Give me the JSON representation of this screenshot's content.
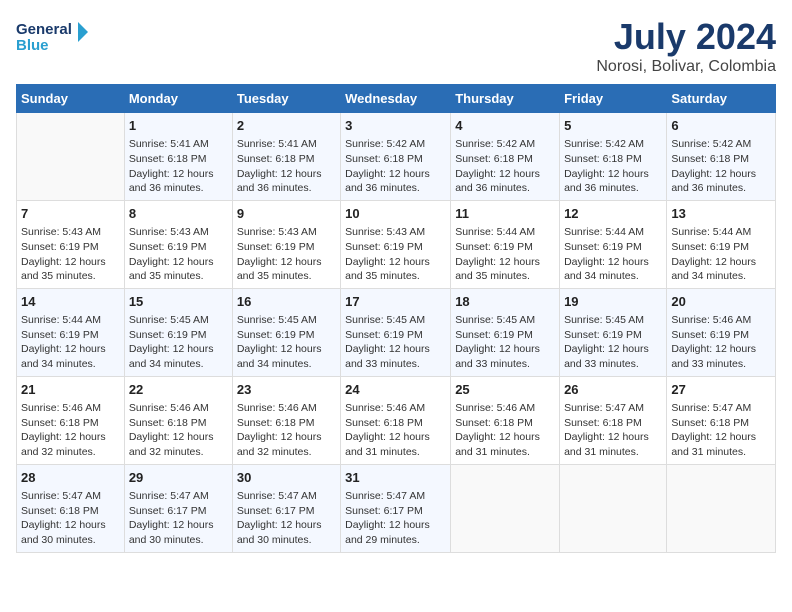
{
  "header": {
    "logo_line1": "General",
    "logo_line2": "Blue",
    "month_year": "July 2024",
    "location": "Norosi, Bolivar, Colombia"
  },
  "days_of_week": [
    "Sunday",
    "Monday",
    "Tuesday",
    "Wednesday",
    "Thursday",
    "Friday",
    "Saturday"
  ],
  "weeks": [
    [
      {
        "day": null
      },
      {
        "day": 1,
        "sunrise": "5:41 AM",
        "sunset": "6:18 PM",
        "daylight": "12 hours and 36 minutes."
      },
      {
        "day": 2,
        "sunrise": "5:41 AM",
        "sunset": "6:18 PM",
        "daylight": "12 hours and 36 minutes."
      },
      {
        "day": 3,
        "sunrise": "5:42 AM",
        "sunset": "6:18 PM",
        "daylight": "12 hours and 36 minutes."
      },
      {
        "day": 4,
        "sunrise": "5:42 AM",
        "sunset": "6:18 PM",
        "daylight": "12 hours and 36 minutes."
      },
      {
        "day": 5,
        "sunrise": "5:42 AM",
        "sunset": "6:18 PM",
        "daylight": "12 hours and 36 minutes."
      },
      {
        "day": 6,
        "sunrise": "5:42 AM",
        "sunset": "6:18 PM",
        "daylight": "12 hours and 36 minutes."
      }
    ],
    [
      {
        "day": 7,
        "sunrise": "5:43 AM",
        "sunset": "6:19 PM",
        "daylight": "12 hours and 35 minutes."
      },
      {
        "day": 8,
        "sunrise": "5:43 AM",
        "sunset": "6:19 PM",
        "daylight": "12 hours and 35 minutes."
      },
      {
        "day": 9,
        "sunrise": "5:43 AM",
        "sunset": "6:19 PM",
        "daylight": "12 hours and 35 minutes."
      },
      {
        "day": 10,
        "sunrise": "5:43 AM",
        "sunset": "6:19 PM",
        "daylight": "12 hours and 35 minutes."
      },
      {
        "day": 11,
        "sunrise": "5:44 AM",
        "sunset": "6:19 PM",
        "daylight": "12 hours and 35 minutes."
      },
      {
        "day": 12,
        "sunrise": "5:44 AM",
        "sunset": "6:19 PM",
        "daylight": "12 hours and 34 minutes."
      },
      {
        "day": 13,
        "sunrise": "5:44 AM",
        "sunset": "6:19 PM",
        "daylight": "12 hours and 34 minutes."
      }
    ],
    [
      {
        "day": 14,
        "sunrise": "5:44 AM",
        "sunset": "6:19 PM",
        "daylight": "12 hours and 34 minutes."
      },
      {
        "day": 15,
        "sunrise": "5:45 AM",
        "sunset": "6:19 PM",
        "daylight": "12 hours and 34 minutes."
      },
      {
        "day": 16,
        "sunrise": "5:45 AM",
        "sunset": "6:19 PM",
        "daylight": "12 hours and 34 minutes."
      },
      {
        "day": 17,
        "sunrise": "5:45 AM",
        "sunset": "6:19 PM",
        "daylight": "12 hours and 33 minutes."
      },
      {
        "day": 18,
        "sunrise": "5:45 AM",
        "sunset": "6:19 PM",
        "daylight": "12 hours and 33 minutes."
      },
      {
        "day": 19,
        "sunrise": "5:45 AM",
        "sunset": "6:19 PM",
        "daylight": "12 hours and 33 minutes."
      },
      {
        "day": 20,
        "sunrise": "5:46 AM",
        "sunset": "6:19 PM",
        "daylight": "12 hours and 33 minutes."
      }
    ],
    [
      {
        "day": 21,
        "sunrise": "5:46 AM",
        "sunset": "6:18 PM",
        "daylight": "12 hours and 32 minutes."
      },
      {
        "day": 22,
        "sunrise": "5:46 AM",
        "sunset": "6:18 PM",
        "daylight": "12 hours and 32 minutes."
      },
      {
        "day": 23,
        "sunrise": "5:46 AM",
        "sunset": "6:18 PM",
        "daylight": "12 hours and 32 minutes."
      },
      {
        "day": 24,
        "sunrise": "5:46 AM",
        "sunset": "6:18 PM",
        "daylight": "12 hours and 31 minutes."
      },
      {
        "day": 25,
        "sunrise": "5:46 AM",
        "sunset": "6:18 PM",
        "daylight": "12 hours and 31 minutes."
      },
      {
        "day": 26,
        "sunrise": "5:47 AM",
        "sunset": "6:18 PM",
        "daylight": "12 hours and 31 minutes."
      },
      {
        "day": 27,
        "sunrise": "5:47 AM",
        "sunset": "6:18 PM",
        "daylight": "12 hours and 31 minutes."
      }
    ],
    [
      {
        "day": 28,
        "sunrise": "5:47 AM",
        "sunset": "6:18 PM",
        "daylight": "12 hours and 30 minutes."
      },
      {
        "day": 29,
        "sunrise": "5:47 AM",
        "sunset": "6:17 PM",
        "daylight": "12 hours and 30 minutes."
      },
      {
        "day": 30,
        "sunrise": "5:47 AM",
        "sunset": "6:17 PM",
        "daylight": "12 hours and 30 minutes."
      },
      {
        "day": 31,
        "sunrise": "5:47 AM",
        "sunset": "6:17 PM",
        "daylight": "12 hours and 29 minutes."
      },
      {
        "day": null
      },
      {
        "day": null
      },
      {
        "day": null
      }
    ]
  ]
}
